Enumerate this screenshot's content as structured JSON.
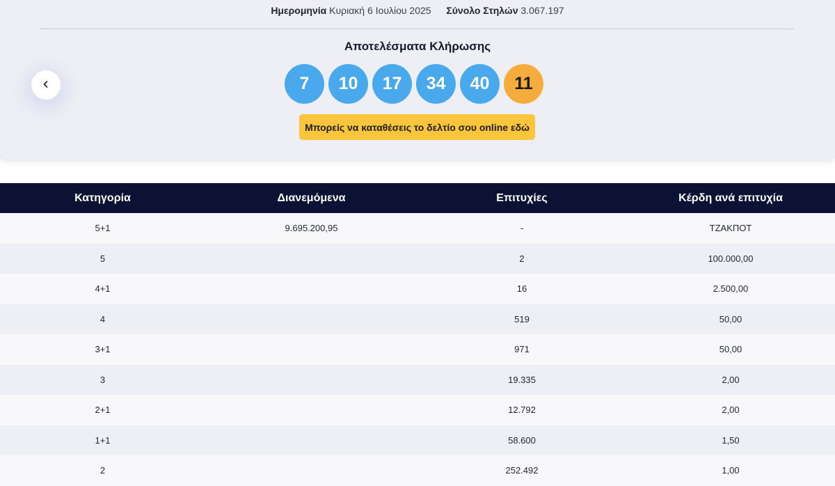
{
  "header": {
    "date_label": "Ημερομηνία",
    "date_value": "Κυριακή 6 Ιουλίου 2025",
    "columns_label": "Σύνολο Στηλών",
    "columns_value": "3.067.197"
  },
  "results": {
    "title": "Αποτελέσματα Κλήρωσης",
    "numbers": [
      "7",
      "10",
      "17",
      "34",
      "40"
    ],
    "bonus": "11",
    "cta_label": "Μπορείς να καταθέσεις το δελτίο σου online εδώ",
    "prev_icon": "chevron-left-icon"
  },
  "table": {
    "headers": [
      "Κατηγορία",
      "Διανεμόμενα",
      "Επιτυχίες",
      "Κέρδη ανά επιτυχία"
    ],
    "rows": [
      [
        "5+1",
        "9.695.200,95",
        "-",
        "ΤΖΑΚΠΟΤ"
      ],
      [
        "5",
        "",
        "2",
        "100.000,00"
      ],
      [
        "4+1",
        "",
        "16",
        "2.500,00"
      ],
      [
        "4",
        "",
        "519",
        "50,00"
      ],
      [
        "3+1",
        "",
        "971",
        "50,00"
      ],
      [
        "3",
        "",
        "19.335",
        "2,00"
      ],
      [
        "2+1",
        "",
        "12.792",
        "2,00"
      ],
      [
        "1+1",
        "",
        "58.600",
        "1,50"
      ],
      [
        "2",
        "",
        "252.492",
        "1,00"
      ]
    ]
  },
  "colors": {
    "ball_main": "#4aa9ec",
    "ball_bonus": "#f4ac3d",
    "cta": "#f8c53c",
    "table_header": "#0b1233"
  }
}
